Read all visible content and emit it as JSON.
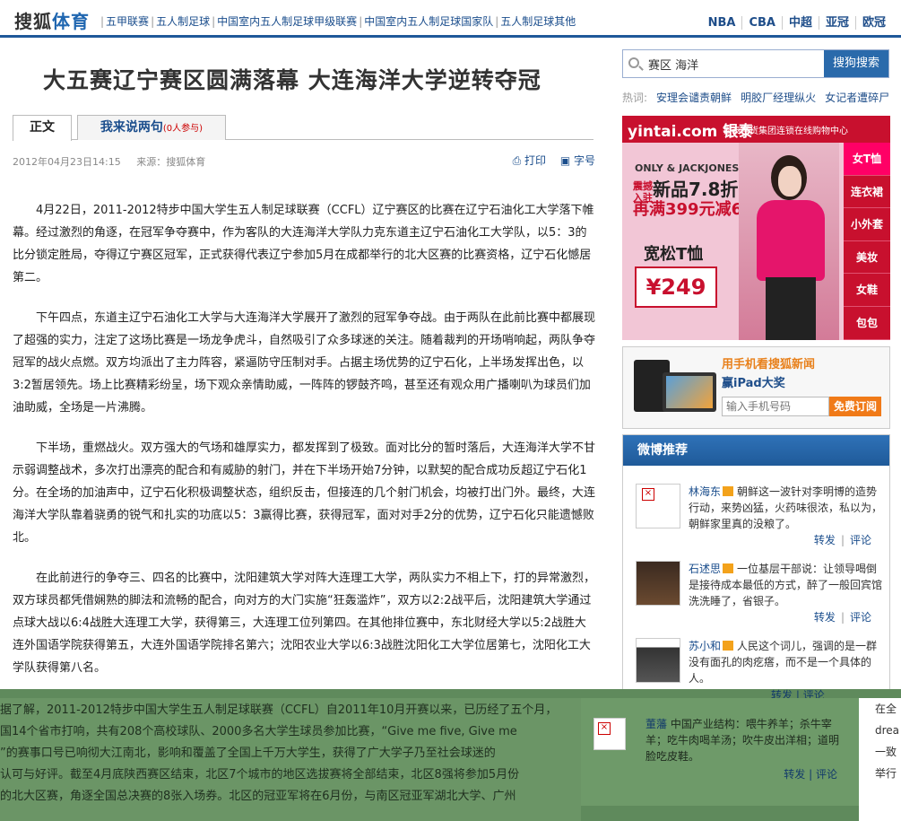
{
  "header": {
    "logo_a": "搜狐",
    "logo_b": "体育",
    "channels": [
      "五甲联赛",
      "五人制足球",
      "中国室内五人制足球甲级联赛",
      "中国室内五人制足球国家队",
      "五人制足球其他"
    ],
    "links": [
      "NBA",
      "CBA",
      "中超",
      "亚冠",
      "欧冠"
    ]
  },
  "article": {
    "title": "大五赛辽宁赛区圆满落幕 大连海洋大学逆转夺冠",
    "tab_main": "正文",
    "tab_comment": "我来说两句",
    "tab_count": "(0人参与)",
    "date": "2012年04月23日14:15",
    "source": "来源：搜狐体育",
    "print": "打印",
    "font": "字号",
    "paragraphs": [
      "4月22日，2011-2012特步中国大学生五人制足球联赛（CCFL）辽宁赛区的比赛在辽宁石油化工大学落下帷幕。经过激烈的角逐，在冠军争夺赛中，作为客队的大连海洋大学队力克东道主辽宁石油化工大学队，以5：3的比分锁定胜局，夺得辽宁赛区冠军，正式获得代表辽宁参加5月在成都举行的北大区赛的比赛资格，辽宁石化憾居第二。",
      "下午四点，东道主辽宁石油化工大学与大连海洋大学展开了激烈的冠军争夺战。由于两队在此前比赛中都展现了超强的实力，注定了这场比赛是一场龙争虎斗，自然吸引了众多球迷的关注。随着裁判的开场哨响起，两队争夺冠军的战火点燃。双方均派出了主力阵容，紧逼防守压制对手。占据主场优势的辽宁石化，上半场发挥出色，以3:2暂居领先。场上比赛精彩纷呈，场下观众亲情助威，一阵阵的锣鼓齐鸣，甚至还有观众用广播喇叭为球员们加油助威，全场是一片沸腾。",
      "下半场，重燃战火。双方强大的气场和雄厚实力，都发挥到了极致。面对比分的暂时落后，大连海洋大学不甘示弱调整战术，多次打出漂亮的配合和有威胁的射门，并在下半场开始7分钟，以默契的配合成功反超辽宁石化1分。在全场的加油声中，辽宁石化积极调整状态，组织反击，但接连的几个射门机会，均被打出门外。最终，大连海洋大学队靠着骁勇的锐气和扎实的功底以5：3赢得比赛，获得冠军，面对对手2分的优势，辽宁石化只能遗憾败北。",
      "在此前进行的争夺三、四名的比赛中，沈阳建筑大学对阵大连理工大学，两队实力不相上下，打的异常激烈，双方球员都凭借娴熟的脚法和流畅的配合，向对方的大门实施“狂轰滥炸”，双方以2:2战平后，沈阳建筑大学通过点球大战以6:4战胜大连理工大学，获得第三，大连理工位列第四。在其他排位赛中，东北财经大学以5:2战胜大连外国语学院获得第五，大连外国语学院排名第六；沈阳农业大学以6:3战胜沈阳化工大学位居第七，沈阳化工大学队获得第八名。"
    ],
    "overlay_lines": [
      "据了解，2011-2012特步中国大学生五人制足球联赛（CCFL）自2011年10月开赛以来，已历经了五个月，",
      "国14个省市打响，共有208个高校球队、2000多名大学生球员参加比赛，“Give me five, Give me",
      "”的赛事口号已响彻大江南北，影响和覆盖了全国上千万大学生，获得了广大学子乃至社会球迷的",
      "认可与好评。截至4月底陕西赛区结束，北区7个城市的地区选拔赛将全部结束，北区8强将参加5月份",
      "的北大区赛，角逐全国总决赛的8张入场券。北区的冠亚军将在6月份，与南区冠亚军湖北大学、广州"
    ]
  },
  "search": {
    "value": "赛区 海洋",
    "button": "搜狗搜索",
    "hot_label": "热词:",
    "hot": [
      "安理会谴责朝鲜",
      "明胶厂经理纵火",
      "女记者遭碎尸"
    ]
  },
  "ad1": {
    "brand": "yintai.com 银泰",
    "sub": "银泰百货集团连锁在线购物中心",
    "brand2": "ONLY & JACKJONES",
    "l1": "震撼入驻",
    "newtxt": "新品7.8折",
    "l2": "再满399元减60",
    "tee": "宽松T恤",
    "price": "¥249",
    "side": [
      "女T恤",
      "连衣裙",
      "小外套",
      "美妆",
      "女鞋",
      "包包"
    ]
  },
  "ad2": {
    "t1": "用手机看搜狐新闻",
    "t2": "赢iPad大奖",
    "placeholder": "输入手机号码",
    "button": "免费订阅"
  },
  "weibo": {
    "title": "微博推荐",
    "items": [
      {
        "name": "林海东",
        "text": "朝鲜这一波针对李明博的造势行动，来势凶猛，火药味很浓，私以为，朝鲜家里真的没粮了。",
        "repost": "转发",
        "comment": "评论"
      },
      {
        "name": "石述思",
        "text": "一位基层干部说：让领导喝倒是接待成本最低的方式，醉了一般回宾馆洗洗睡了，省银子。",
        "repost": "转发",
        "comment": "评论"
      },
      {
        "name": "苏小和",
        "text": "人民这个词儿，强调的是一群没有面孔的肉疙瘩，而不是一个具体的人。",
        "repost": "转发",
        "comment": "评论"
      },
      {
        "name": "董藩",
        "text": "中国产业结构：喂牛养羊；杀牛宰羊；吃牛肉喝羊汤；吹牛皮出洋相；道明脸吃皮鞋。",
        "repost": "转发",
        "comment": "评论"
      }
    ]
  },
  "overlay_right": [
    "在全",
    "drea",
    "一致",
    "举行"
  ]
}
